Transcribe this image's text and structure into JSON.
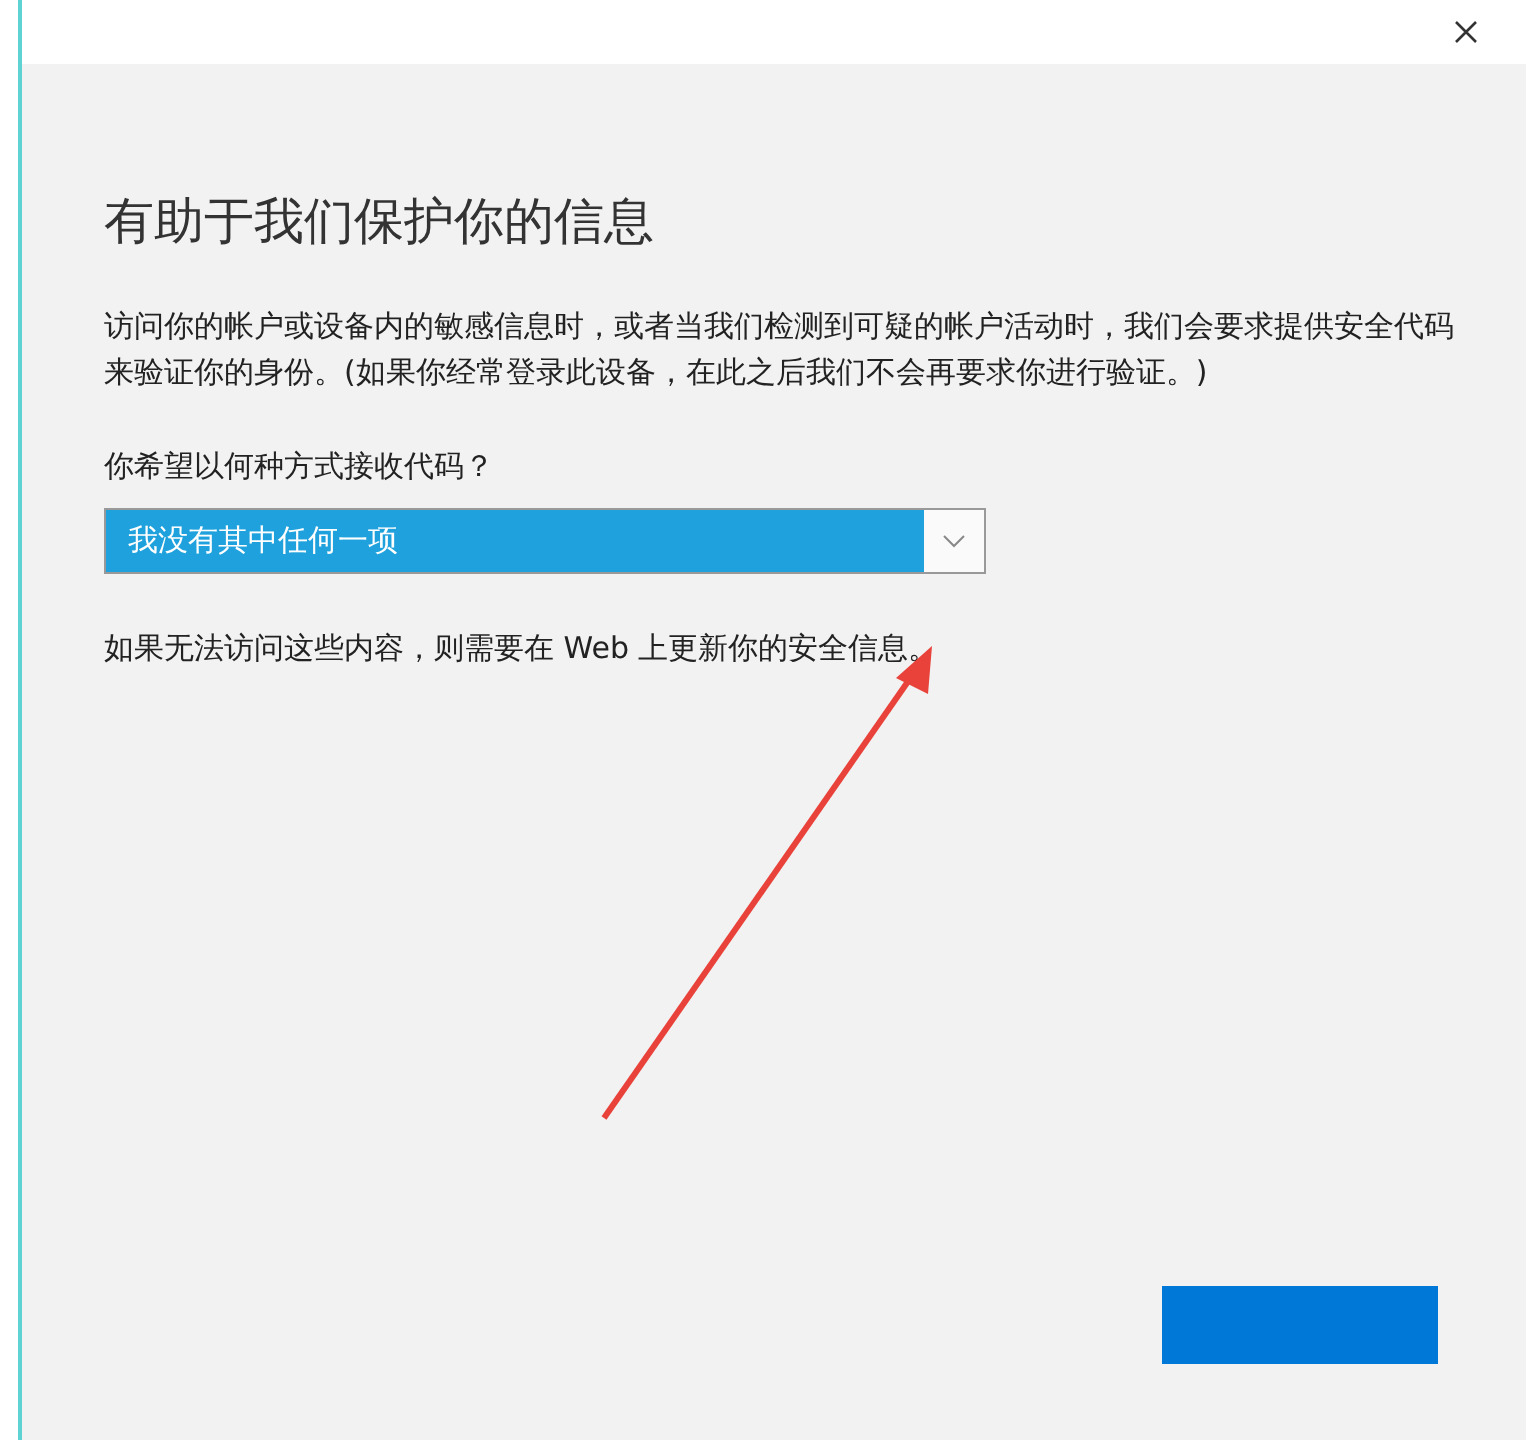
{
  "dialog": {
    "title": "有助于我们保护你的信息",
    "description": "访问你的帐户或设备内的敏感信息时，或者当我们检测到可疑的帐户活动时，我们会要求提供安全代码来验证你的身份。(如果你经常登录此设备，在此之后我们不会再要求你进行验证。)",
    "question": "你希望以何种方式接收代码？",
    "dropdown": {
      "value": "我没有其中任何一项"
    },
    "note": "如果无法访问这些内容，则需要在 Web 上更新你的安全信息。"
  }
}
